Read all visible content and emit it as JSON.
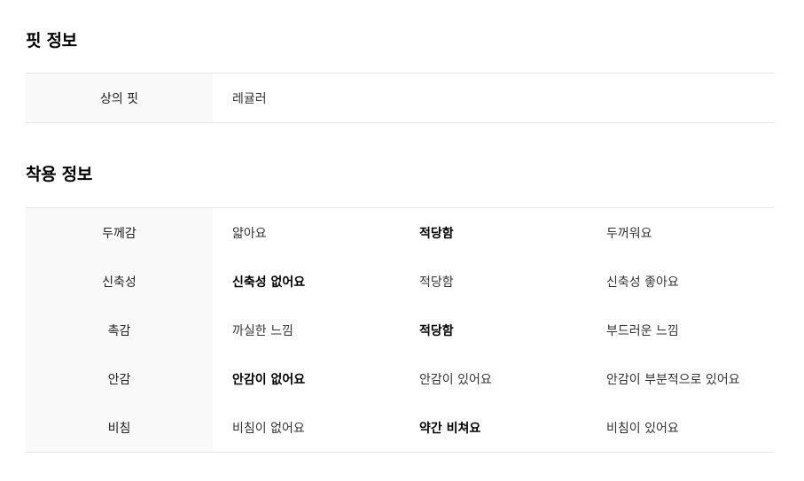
{
  "fit_section": {
    "title": "핏 정보",
    "rows": [
      {
        "label": "상의 핏",
        "value": "레귤러"
      }
    ]
  },
  "wear_section": {
    "title": "착용 정보",
    "rows": [
      {
        "label": "두께감",
        "options": [
          "얇아요",
          "적당함",
          "두꺼워요"
        ],
        "selected": 1
      },
      {
        "label": "신축성",
        "options": [
          "신축성 없어요",
          "적당함",
          "신축성 좋아요"
        ],
        "selected": 0
      },
      {
        "label": "촉감",
        "options": [
          "까실한 느낌",
          "적당함",
          "부드러운 느낌"
        ],
        "selected": 1
      },
      {
        "label": "안감",
        "options": [
          "안감이 없어요",
          "안감이 있어요",
          "안감이 부분적으로 있어요"
        ],
        "selected": 0
      },
      {
        "label": "비침",
        "options": [
          "비침이 없어요",
          "약간 비쳐요",
          "비침이 있어요"
        ],
        "selected": 1
      }
    ]
  }
}
